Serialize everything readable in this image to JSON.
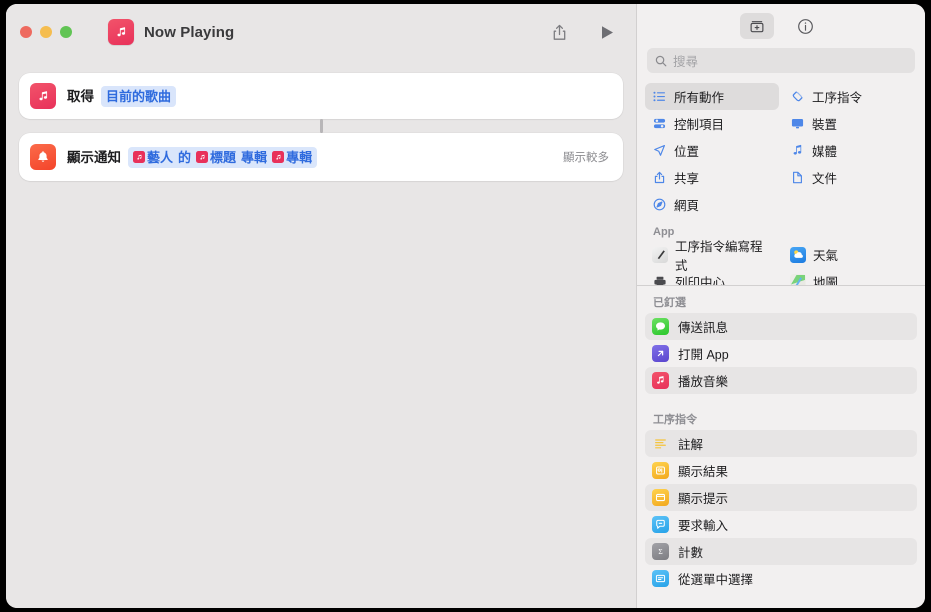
{
  "window": {
    "title": "Now Playing",
    "traffic_lights": [
      "close",
      "minimize",
      "maximize"
    ],
    "app_icon": "music-note-icon",
    "toolbar": {
      "share_label": "share-icon",
      "run_label": "play-icon"
    }
  },
  "editor": {
    "actions": [
      {
        "icon": "music-note-icon",
        "title": "取得",
        "token": "目前的歌曲"
      },
      {
        "icon": "bell-icon",
        "title": "顯示通知",
        "tokens": [
          {
            "type": "var",
            "text": "藝人"
          },
          {
            "type": "plain",
            "text": "的"
          },
          {
            "type": "var",
            "text": "標題"
          },
          {
            "type": "plain",
            "text": "專輯"
          },
          {
            "type": "var",
            "text": "專輯"
          }
        ],
        "show_more": "顯示較多"
      }
    ]
  },
  "sidebar": {
    "toolbar": {
      "library_label": "add-action-icon",
      "info_label": "info-icon"
    },
    "search": {
      "placeholder": "搜尋",
      "value": "",
      "icon": "search-icon"
    },
    "categories": [
      {
        "label": "所有動作",
        "icon": "list-icon",
        "selected": true
      },
      {
        "label": "工序指令",
        "icon": "shortcuts-icon",
        "selected": false
      },
      {
        "label": "控制項目",
        "icon": "sliders-icon",
        "selected": false
      },
      {
        "label": "裝置",
        "icon": "display-icon",
        "selected": false
      },
      {
        "label": "位置",
        "icon": "location-icon",
        "selected": false
      },
      {
        "label": "媒體",
        "icon": "music-icon",
        "selected": false
      },
      {
        "label": "共享",
        "icon": "share-icon",
        "selected": false
      },
      {
        "label": "文件",
        "icon": "document-icon",
        "selected": false
      },
      {
        "label": "網頁",
        "icon": "safari-icon",
        "selected": false
      }
    ],
    "app_section": {
      "header": "App",
      "items": [
        {
          "label": "工序指令編寫程式",
          "icon": "script-editor-icon"
        },
        {
          "label": "天氣",
          "icon": "weather-icon"
        },
        {
          "label": "列印中心",
          "icon": "printer-icon"
        },
        {
          "label": "地圖",
          "icon": "maps-icon"
        }
      ]
    },
    "pinned_section": {
      "header": "已釘選",
      "items": [
        {
          "label": "傳送訊息",
          "icon": "messages-icon"
        },
        {
          "label": "打開 App",
          "icon": "open-app-icon"
        },
        {
          "label": "播放音樂",
          "icon": "music-note-icon"
        }
      ]
    },
    "shortcuts_section": {
      "header": "工序指令",
      "items": [
        {
          "label": "註解",
          "icon": "comment-icon"
        },
        {
          "label": "顯示結果",
          "icon": "show-result-icon"
        },
        {
          "label": "顯示提示",
          "icon": "show-alert-icon"
        },
        {
          "label": "要求輸入",
          "icon": "ask-input-icon"
        },
        {
          "label": "計數",
          "icon": "count-icon"
        },
        {
          "label": "從選單中選擇",
          "icon": "choose-menu-icon"
        }
      ]
    }
  },
  "colors": {
    "accent_blue": "#4E87E8",
    "token_blue": "#2F6BDE",
    "token_bg": "#DAE6FB",
    "music_red": "#E8315A",
    "bell_orange": "#F4442A",
    "window_bg": "#E8E6E6",
    "sidebar_bg": "#F2F0F0"
  }
}
